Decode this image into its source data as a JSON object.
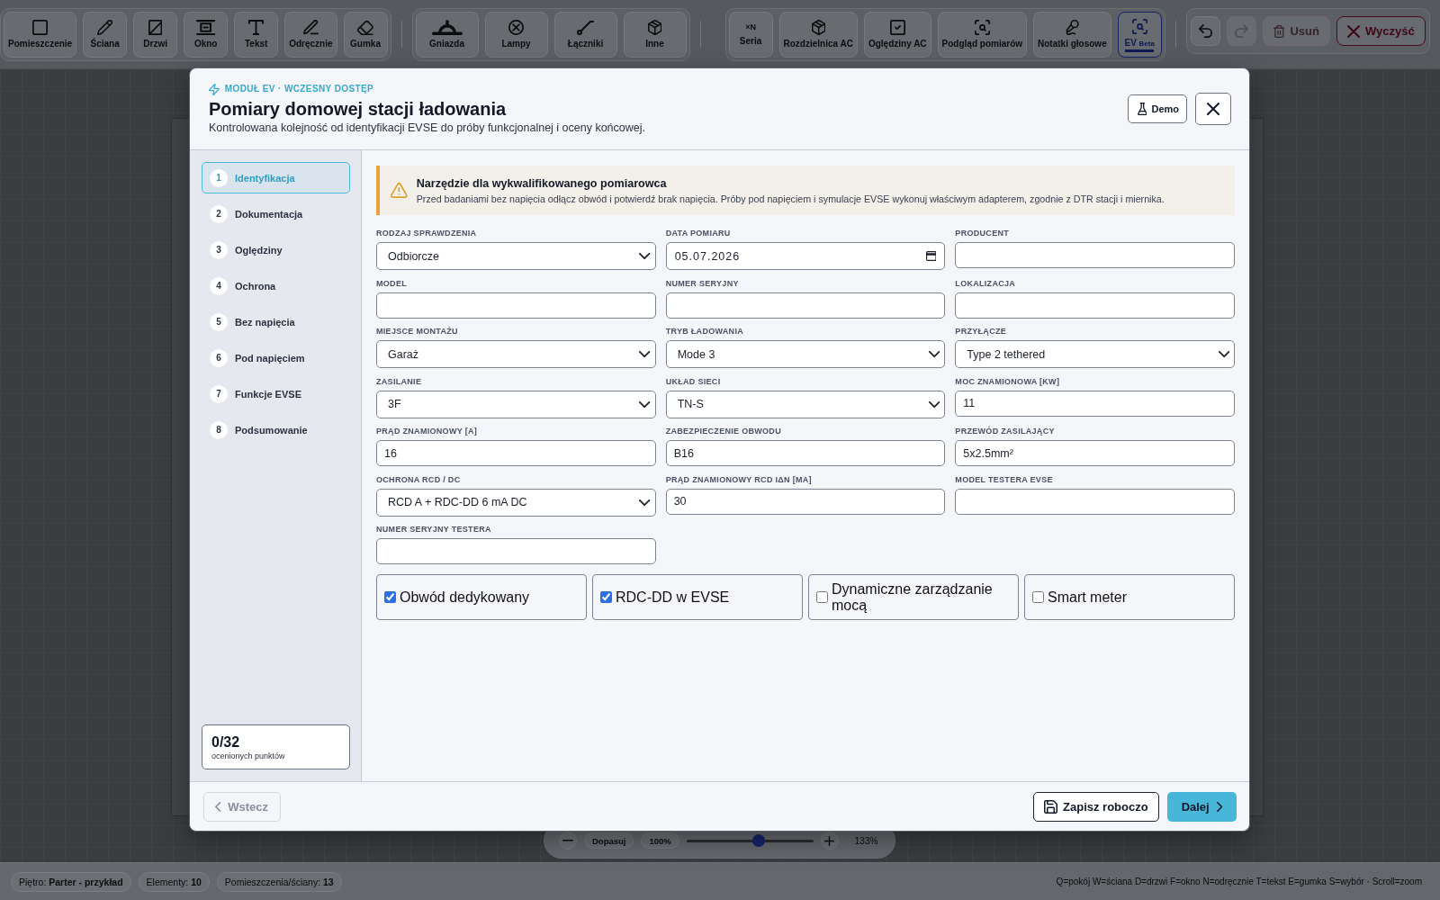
{
  "toolbar": {
    "groups": [
      {
        "tools": [
          {
            "label": "Pomieszczenie",
            "selected": false
          },
          {
            "label": "Ściana",
            "selected": false
          },
          {
            "label": "Drzwi",
            "selected": false
          },
          {
            "label": "Okno",
            "selected": false
          },
          {
            "label": "Tekst",
            "selected": false
          },
          {
            "label": "Odręcznie",
            "selected": false
          },
          {
            "label": "Gumka",
            "selected": false
          }
        ]
      },
      {
        "tools": [
          {
            "label": "Gniazda",
            "selected": false
          },
          {
            "label": "Lampy",
            "selected": false
          },
          {
            "label": "Łączniki",
            "selected": false
          },
          {
            "label": "Inne",
            "selected": false
          }
        ]
      },
      {
        "tools": [
          {
            "glyph": "×N",
            "label": "Seria",
            "selected": false
          },
          {
            "label": "Rozdzielnica AC",
            "selected": false
          },
          {
            "label": "Oględziny AC",
            "selected": false
          },
          {
            "label": "Podgląd pomiarów",
            "selected": false
          },
          {
            "label": "Notatki głosowe",
            "selected": false
          },
          {
            "label": "EV",
            "badge": "Beta",
            "selected": true
          }
        ]
      }
    ],
    "history": [
      {
        "disabled": false
      },
      {
        "disabled": true
      }
    ],
    "actions": [
      {
        "kind": "delete",
        "label": "Usuń",
        "disabled": true
      },
      {
        "kind": "clear",
        "label": "Wyczyść",
        "disabled": false
      }
    ]
  },
  "canvas": {
    "zoom": {
      "fit_label": "Dopasuj",
      "reset_label": "100%",
      "level": 0.57,
      "reading": "133%"
    }
  },
  "modal": {
    "eyebrow": "MODUŁ EV · WCZESNY DOSTĘP",
    "title": "Pomiary domowej stacji ładowania",
    "subtitle": "Kontrolowana kolejność od identyfikacji EVSE do próby funkcjonalnej i oceny końcowej.",
    "demo_button": "Demo",
    "steps": [
      {
        "number": "1",
        "label": "Identyfikacja",
        "selected": true
      },
      {
        "number": "2",
        "label": "Dokumentacja",
        "selected": false
      },
      {
        "number": "3",
        "label": "Oględziny",
        "selected": false
      },
      {
        "number": "4",
        "label": "Ochrona",
        "selected": false
      },
      {
        "number": "5",
        "label": "Bez napięcia",
        "selected": false
      },
      {
        "number": "6",
        "label": "Pod napięciem",
        "selected": false
      },
      {
        "number": "7",
        "label": "Funkcje EVSE",
        "selected": false
      },
      {
        "number": "8",
        "label": "Podsumowanie",
        "selected": false
      }
    ],
    "progress": {
      "value": "0/32",
      "caption": "ocenionych punktów"
    },
    "warning": {
      "title": "Narzędzie dla wykwalifikowanego pomiarowca",
      "text": "Przed badaniami bez napięcia odłącz obwód i potwierdź brak napięcia. Próby pod napięciem i symulacje EVSE wykonuj właściwym adapterem, zgodnie z DTR stacji i miernika."
    },
    "fields": [
      {
        "kind": "select",
        "label": "RODZAJ SPRAWDZENIA",
        "value": "Odbiorcze"
      },
      {
        "kind": "date",
        "label": "DATA POMIARU",
        "value": "05.07.2026"
      },
      {
        "kind": "text",
        "label": "PRODUCENT"
      },
      {
        "kind": "text",
        "label": "MODEL"
      },
      {
        "kind": "text",
        "label": "NUMER SERYJNY"
      },
      {
        "kind": "text",
        "label": "LOKALIZACJA"
      },
      {
        "kind": "select",
        "label": "MIEJSCE MONTAŻU",
        "value": "Garaż"
      },
      {
        "kind": "select",
        "label": "TRYB ŁADOWANIA",
        "value": "Mode 3"
      },
      {
        "kind": "select",
        "label": "PRZYŁĄCZE",
        "value": "Type 2 tethered"
      },
      {
        "kind": "select",
        "label": "ZASILANIE",
        "value": "3F"
      },
      {
        "kind": "select",
        "label": "UKŁAD SIECI",
        "value": "TN-S"
      },
      {
        "kind": "text",
        "label": "MOC ZNAMIONOWA [KW]",
        "value": "11"
      },
      {
        "kind": "text",
        "label": "PRĄD ZNAMIONOWY [A]",
        "value": "16"
      },
      {
        "kind": "text",
        "label": "ZABEZPIECZENIE OBWODU",
        "value": "B16"
      },
      {
        "kind": "text",
        "label": "PRZEWÓD ZASILAJĄCY",
        "value": "5x2.5mm²"
      },
      {
        "kind": "select",
        "label": "OCHRONA RCD / DC",
        "value": "RCD A + RDC-DD 6 mA DC"
      },
      {
        "kind": "text",
        "label": "PRĄD ZNAMIONOWY RCD IΔN [MA]",
        "value": "30"
      },
      {
        "kind": "text",
        "label": "MODEL TESTERA EVSE"
      },
      {
        "kind": "text",
        "label": "NUMER SERYJNY TESTERA"
      }
    ],
    "options": [
      {
        "label": "Obwód dedykowany",
        "checked": true
      },
      {
        "label": "RDC-DD w EVSE",
        "checked": true
      },
      {
        "label": "Dynamiczne zarządzanie mocą",
        "checked": false
      },
      {
        "label": "Smart meter",
        "checked": false
      }
    ],
    "footer": {
      "back": {
        "label": "Wstecz",
        "disabled": true
      },
      "save": "Zapisz roboczo",
      "next": "Dalej"
    }
  },
  "status_bar": {
    "items": [
      "Piętro: **Parter - przykład**",
      "Elementy: **10**",
      "Pomieszczenia/ściany: **13**"
    ],
    "hint": "Q=pokój W=ściana D=drzwi F=okno N=odręcznie T=tekst E=gumka S=wybór · Scroll=zoom"
  }
}
